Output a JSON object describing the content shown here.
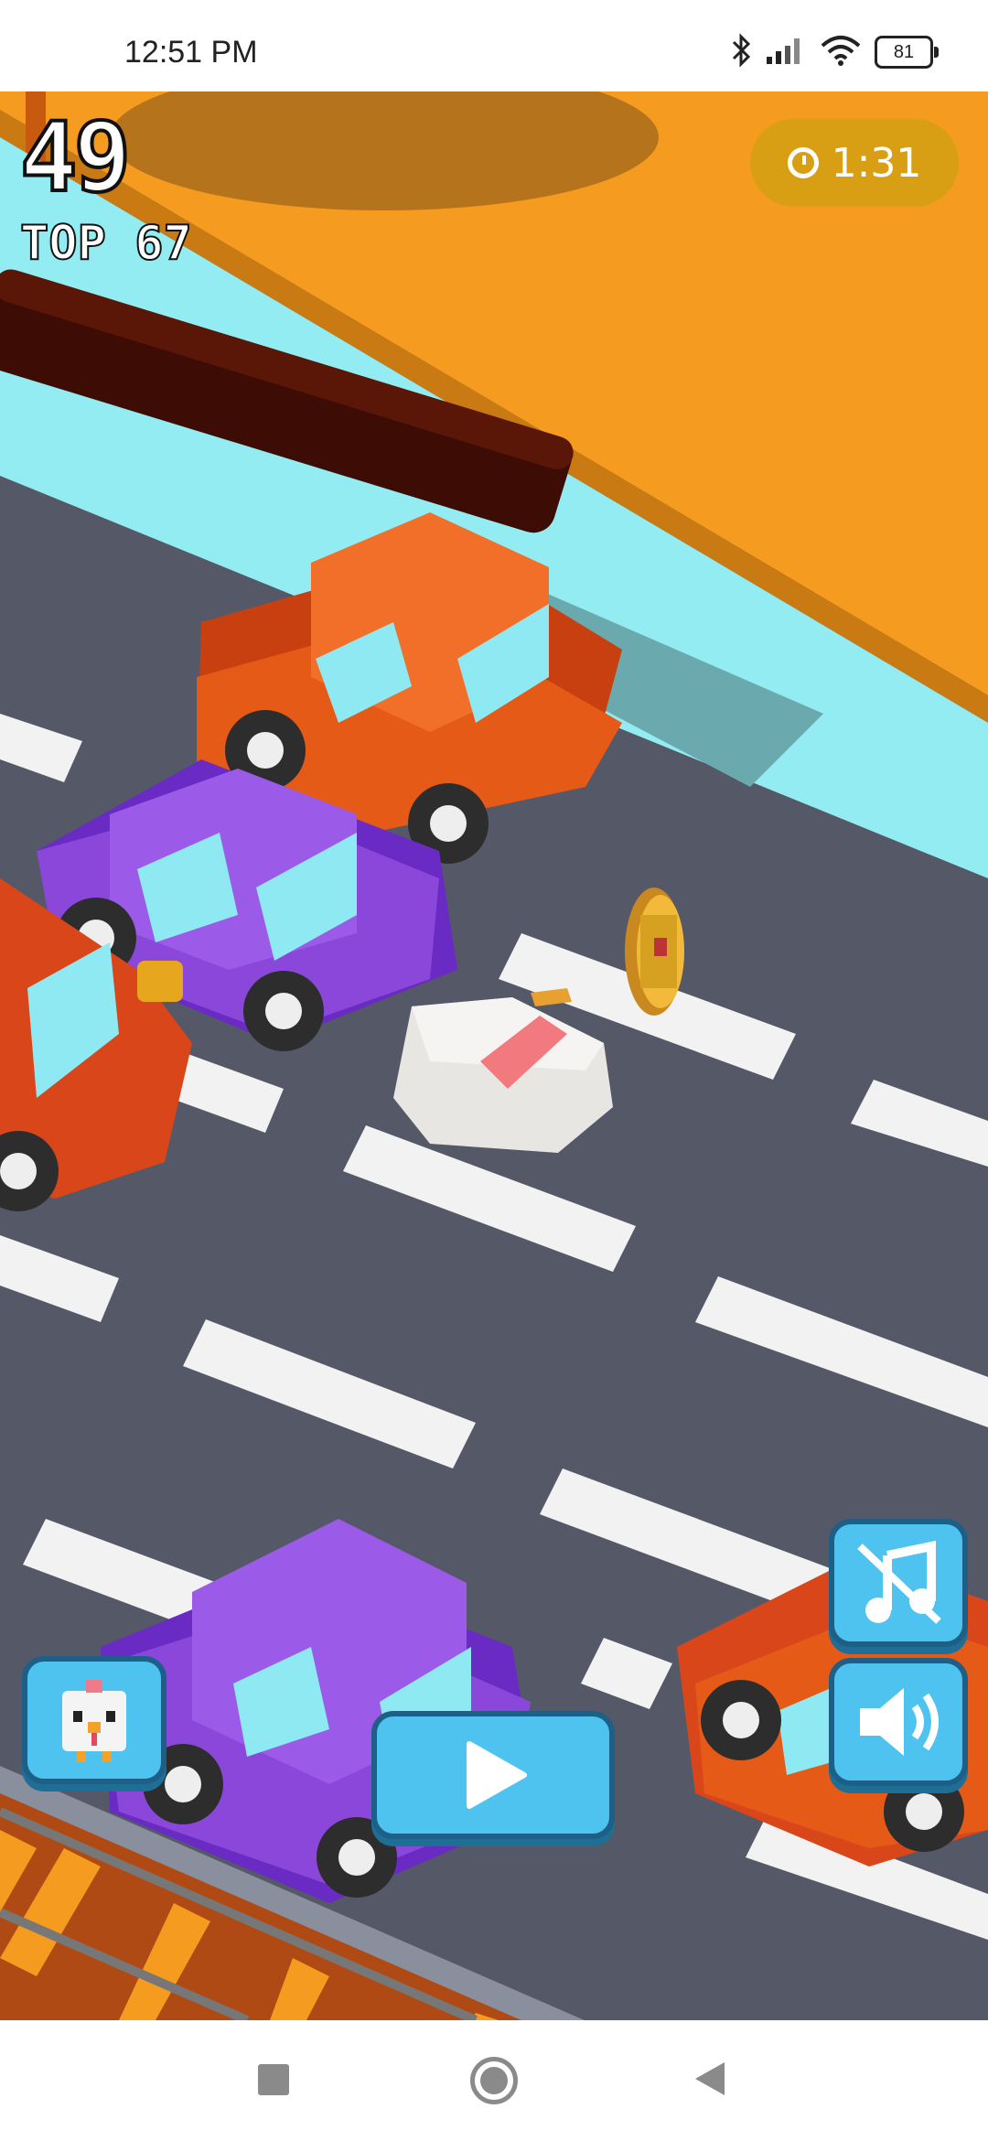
{
  "status_bar": {
    "time": "12:51 PM",
    "battery": "81",
    "icons": [
      "bluetooth-icon",
      "signal-icon",
      "wifi-icon",
      "battery-icon"
    ]
  },
  "hud": {
    "score": "49",
    "top_score": "TOP 67",
    "timer": "1:31",
    "timer_icon": "stopwatch-icon"
  },
  "controls": {
    "character_button_icon": "chicken-icon",
    "play_button_icon": "play-icon",
    "music_button_icon": "music-muted-icon",
    "sound_button_icon": "speaker-icon"
  },
  "nav_bar": {
    "buttons": [
      "recents-button",
      "home-button",
      "back-button"
    ]
  },
  "colors": {
    "sand": "#f59b1f",
    "water": "#92ecf1",
    "road": "#555866",
    "lane_marking": "#f2f2f2",
    "car_orange": "#e65a18",
    "car_purple": "#8b47d9",
    "button_fill": "#4fc3f0",
    "button_border": "#1d5f86",
    "timer_bg": "#d6a014"
  }
}
